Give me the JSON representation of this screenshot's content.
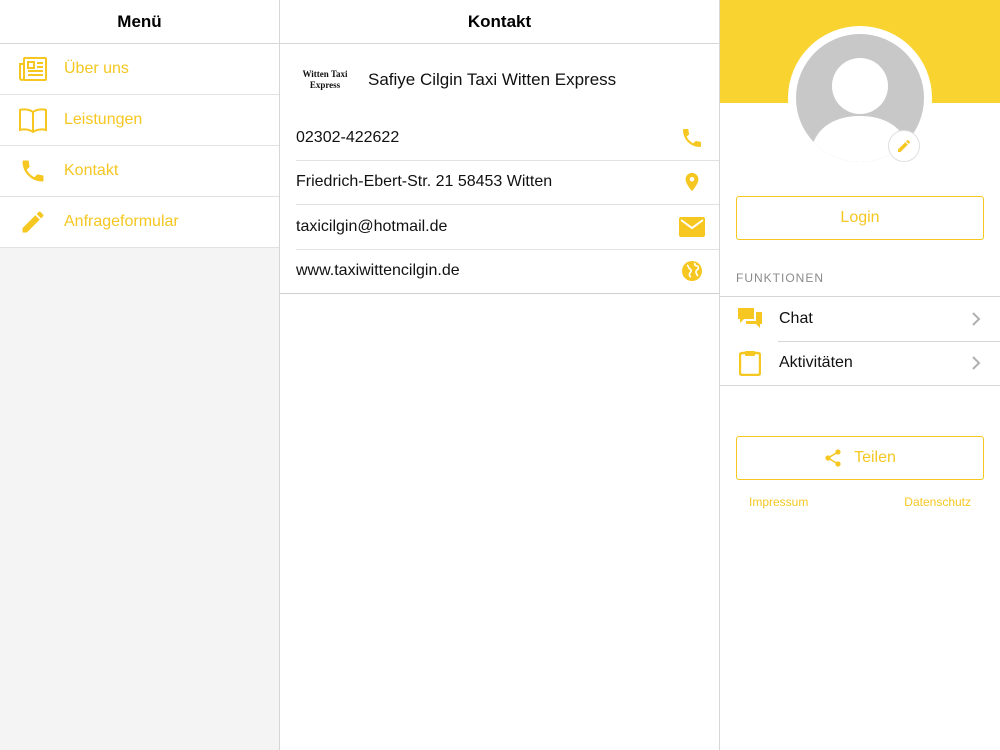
{
  "colors": {
    "accent": "#f5c720",
    "banner": "#f9d431",
    "avatar": "#c8c8c8"
  },
  "menu": {
    "title": "Menü",
    "items": [
      {
        "label": "Über uns",
        "icon": "newspaper-icon"
      },
      {
        "label": "Leistungen",
        "icon": "book-icon"
      },
      {
        "label": "Kontakt",
        "icon": "phone-icon"
      },
      {
        "label": "Anfrageformular",
        "icon": "pencil-icon"
      }
    ]
  },
  "contact": {
    "title": "Kontakt",
    "logo_line1": "Witten Taxi",
    "logo_line2": "Express",
    "company_name": "Safiye Cilgin Taxi Witten Express",
    "rows": [
      {
        "value": "02302-422622",
        "icon": "phone-icon"
      },
      {
        "value": "Friedrich-Ebert-Str. 21 58453 Witten",
        "icon": "location-pin-icon"
      },
      {
        "value": "taxicilgin@hotmail.de",
        "icon": "mail-icon"
      },
      {
        "value": "www.taxiwittencilgin.de",
        "icon": "globe-icon"
      }
    ]
  },
  "profile": {
    "login_label": "Login",
    "section_title": "FUNKTIONEN",
    "functions": [
      {
        "label": "Chat",
        "icon": "chat-icon"
      },
      {
        "label": "Aktivitäten",
        "icon": "clipboard-icon"
      }
    ],
    "share_label": "Teilen",
    "impressum_label": "Impressum",
    "datenschutz_label": "Datenschutz"
  }
}
